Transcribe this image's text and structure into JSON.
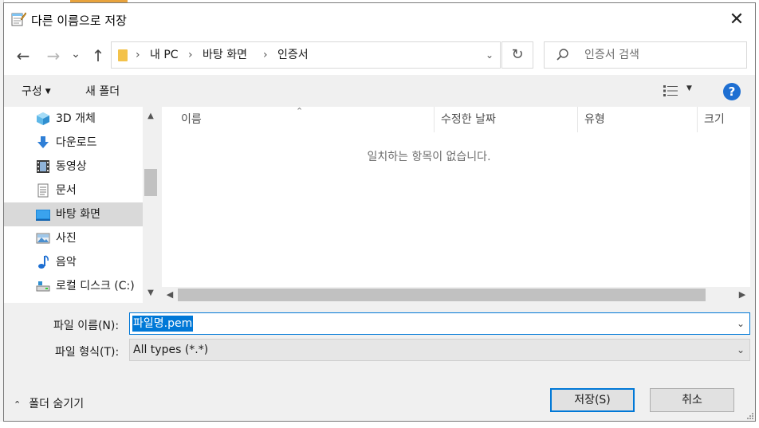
{
  "window": {
    "title": "다른 이름으로 저장",
    "close_glyph": "✕"
  },
  "nav": {
    "back_glyph": "←",
    "forward_glyph": "→",
    "recent_glyph": "⌄",
    "up_glyph": "↑",
    "breadcrumb": [
      "내 PC",
      "바탕 화면",
      "인증서"
    ],
    "separator": "›",
    "refresh_glyph": "↻",
    "search_placeholder": "인증서 검색"
  },
  "toolbar": {
    "organize_label": "구성",
    "new_folder_label": "새 폴더",
    "help_label": "?"
  },
  "sidebar": {
    "items": [
      {
        "label": "3D 개체",
        "icon": "3d-objects-icon"
      },
      {
        "label": "다운로드",
        "icon": "downloads-icon"
      },
      {
        "label": "동영상",
        "icon": "videos-icon"
      },
      {
        "label": "문서",
        "icon": "documents-icon"
      },
      {
        "label": "바탕 화면",
        "icon": "desktop-icon",
        "selected": true
      },
      {
        "label": "사진",
        "icon": "pictures-icon"
      },
      {
        "label": "음악",
        "icon": "music-icon"
      },
      {
        "label": "로컬 디스크 (C:)",
        "icon": "local-disk-icon"
      }
    ]
  },
  "file_list": {
    "columns": [
      "이름",
      "수정한 날짜",
      "유형",
      "크기"
    ],
    "empty_message": "일치하는 항목이 없습니다."
  },
  "form": {
    "filename_label": "파일 이름(N):",
    "filename_value": "파일명.pem",
    "filetype_label": "파일 형식(T):",
    "filetype_value": "All types (*.*)"
  },
  "footer": {
    "hide_folders_label": "폴더 숨기기",
    "save_label": "저장(S)",
    "cancel_label": "취소"
  },
  "colors": {
    "accent": "#0078d7",
    "help": "#1e6fd2",
    "selection": "#d9d9d9"
  }
}
